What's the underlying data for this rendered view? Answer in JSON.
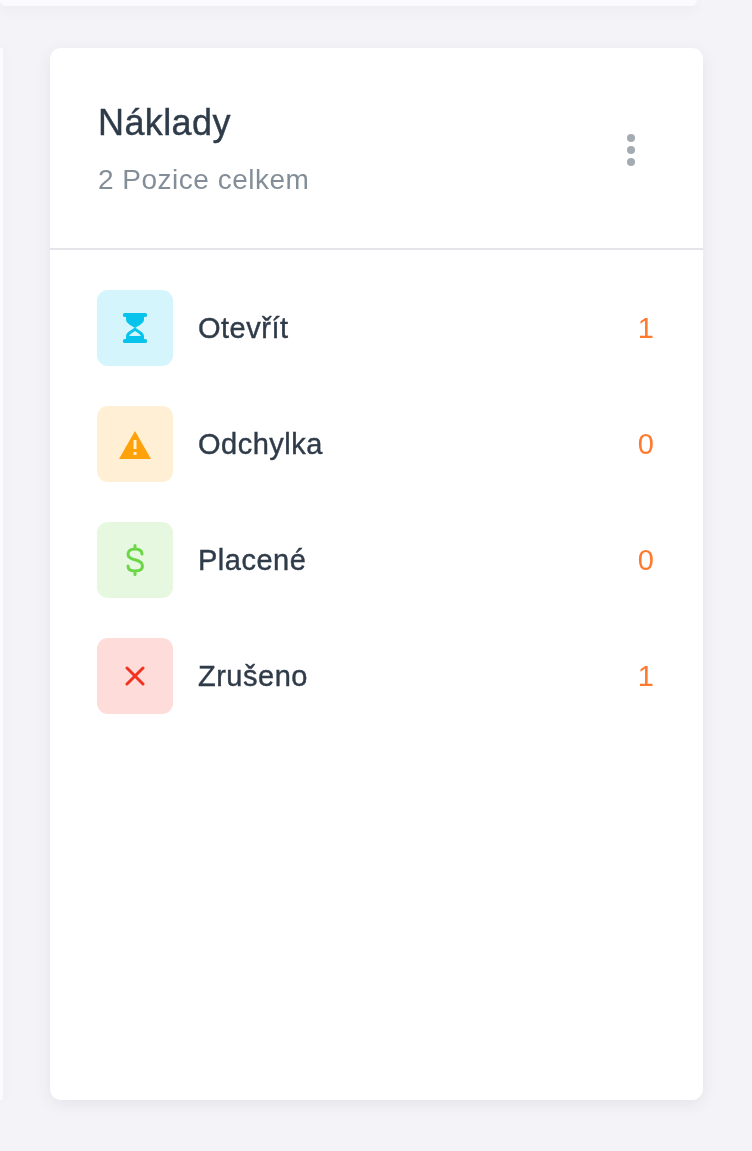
{
  "card": {
    "title": "Náklady",
    "subtitle": "2 Pozice celkem",
    "items": [
      {
        "kind": "hourglass",
        "label": "Otevřít",
        "count": "1",
        "color": "#d5f5fc"
      },
      {
        "kind": "warning",
        "label": "Odchylka",
        "count": "0",
        "color": "#ffefd5"
      },
      {
        "kind": "dollar",
        "label": "Placené",
        "count": "0",
        "color": "#e6f8e0"
      },
      {
        "kind": "cross",
        "label": "Zrušeno",
        "count": "1",
        "color": "#fddcd9"
      }
    ]
  }
}
